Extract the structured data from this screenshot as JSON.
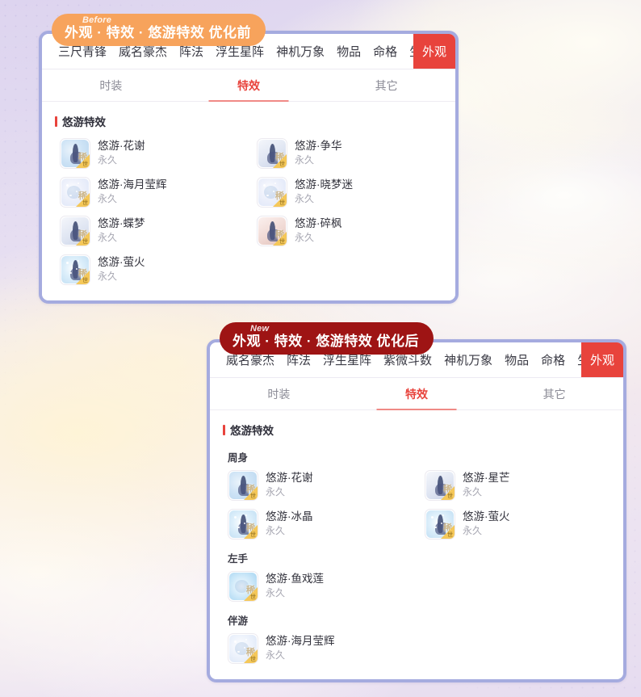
{
  "background": {
    "sky_gradient_from": "#ddd4ef",
    "sky_gradient_to": "#e6dcf0",
    "cloud_color": "#fff8e6"
  },
  "theme": {
    "accent_red": "#e8433c",
    "frame_border": "#a5abdf",
    "before_badge_bg": "#f7a35c",
    "after_badge_bg": "#9e1414",
    "muted_text": "#a7a7b2"
  },
  "panels": [
    {
      "id": "before",
      "ribbon": {
        "tag": "Before",
        "title": "外观 · 特效 · 悠游特效  优化前"
      },
      "topnav": {
        "items": [
          "三尺青锋",
          "威名豪杰",
          "阵法",
          "浮生星阵",
          "神机万象",
          "物品",
          "命格",
          "生活/行当"
        ],
        "active": "外观"
      },
      "subtabs": [
        {
          "label": "时装",
          "active": false
        },
        {
          "label": "特效",
          "active": true
        },
        {
          "label": "其它",
          "active": false
        }
      ],
      "section": {
        "title": "悠游特效"
      },
      "groups": [
        {
          "label": "",
          "items": [
            {
              "name": "悠游·花谢",
              "duration": "永久",
              "art": "art-blue"
            },
            {
              "name": "悠游·争华",
              "duration": "永久",
              "art": "art-dark"
            },
            {
              "name": "悠游·海月莹辉",
              "duration": "永久",
              "art": "art-sparkle"
            },
            {
              "name": "悠游·晓梦迷",
              "duration": "永久",
              "art": "art-sparkle"
            },
            {
              "name": "悠游·蝶梦",
              "duration": "永久",
              "art": "art-dark"
            },
            {
              "name": "悠游·碎枫",
              "duration": "永久",
              "art": "art-red"
            },
            {
              "name": "悠游·萤火",
              "duration": "永久",
              "art": "art-ice"
            }
          ]
        }
      ]
    },
    {
      "id": "after",
      "ribbon": {
        "tag": "New",
        "title": "外观 · 特效 · 悠游特效  优化后"
      },
      "topnav": {
        "items": [
          "威名豪杰",
          "阵法",
          "浮生星阵",
          "紫微斗数",
          "神机万象",
          "物品",
          "命格",
          "生活/行当"
        ],
        "active": "外观"
      },
      "subtabs": [
        {
          "label": "时装",
          "active": false
        },
        {
          "label": "特效",
          "active": true
        },
        {
          "label": "其它",
          "active": false
        }
      ],
      "section": {
        "title": "悠游特效"
      },
      "groups": [
        {
          "label": "周身",
          "items": [
            {
              "name": "悠游·花谢",
              "duration": "永久",
              "art": "art-blue"
            },
            {
              "name": "悠游·星芒",
              "duration": "永久",
              "art": "art-dark"
            },
            {
              "name": "悠游·冰晶",
              "duration": "永久",
              "art": "art-ice"
            },
            {
              "name": "悠游·萤火",
              "duration": "永久",
              "art": "art-ice"
            }
          ]
        },
        {
          "label": "左手",
          "items": [
            {
              "name": "悠游·鱼戏莲",
              "duration": "永久",
              "art": "art-lotus"
            }
          ]
        },
        {
          "label": "伴游",
          "items": [
            {
              "name": "悠游·海月莹辉",
              "duration": "永久",
              "art": "art-moon"
            }
          ]
        }
      ]
    }
  ]
}
